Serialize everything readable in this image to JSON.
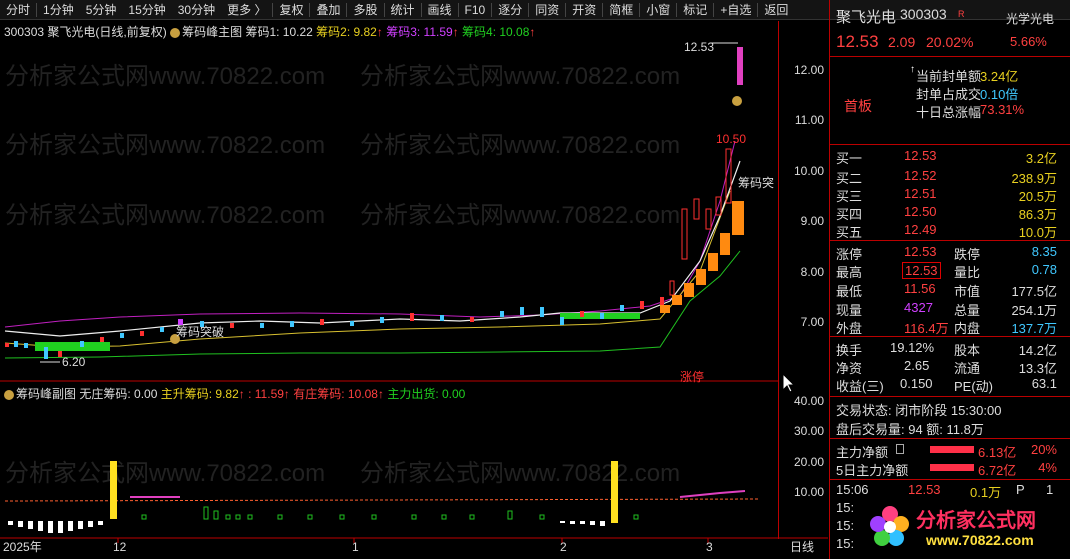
{
  "toolbar": {
    "items": [
      "分时",
      "1分钟",
      "5分钟",
      "15分钟",
      "30分钟",
      "更多 〉"
    ],
    "right_items": [
      "复权",
      "叠加",
      "多股",
      "统计",
      "画线",
      "F10",
      "逐分",
      "同资",
      "开资",
      "简框",
      "小窗",
      "标记",
      "+自选",
      "返回"
    ]
  },
  "main": {
    "code": "300303",
    "name": "聚飞光电",
    "period": "(日线,前复权)",
    "indicator": "筹码峰主图",
    "chip1_label": "筹码1: 10.22",
    "chip2_label": "筹码2: 9.82",
    "chip3_label": "筹码3: 11.59",
    "chip4_label": "筹码4: 10.08",
    "max_label": "12.53",
    "min_label": "6.20",
    "label_1050": "10.50",
    "breakout1": "筹码突破",
    "breakout2": "筹码突",
    "zhangting": "涨停"
  },
  "sub": {
    "title": "筹码峰副图",
    "nz": "无庄筹码: 0.00",
    "main_up": "主升筹码: 9.82",
    "blank_val": ": 11.59",
    "with_zhuang": "有庄筹码: 10.08",
    "main_out": "主力出货: 0.00"
  },
  "yaxis": {
    "main": [
      "12.00",
      "11.00",
      "10.00",
      "9.00",
      "8.00",
      "7.00"
    ],
    "sub": [
      "40.00",
      "30.00",
      "20.00",
      "10.00"
    ]
  },
  "xaxis": {
    "labels": [
      "2025年",
      "12",
      "1",
      "2",
      "3"
    ],
    "right": "日线"
  },
  "watermark": "分析家公式网www.70822.com",
  "panel": {
    "name": "聚飞光电",
    "code": "300303",
    "badge": "R",
    "price": "12.53",
    "change": "2.09",
    "pct": "20.02%",
    "sector": "光学光电",
    "sector_pct": "5.66%",
    "board": "首板",
    "seal_label": "当前封单额",
    "seal_val": "3.24亿",
    "seal_ratio_label": "封单占成交",
    "seal_ratio_val": "0.10倍",
    "ten_day_label": "十日总涨幅",
    "ten_day_val": "73.31%",
    "bids": [
      [
        "买一",
        "12.53",
        "3.2亿"
      ],
      [
        "买二",
        "12.52",
        "238.9万"
      ],
      [
        "买三",
        "12.51",
        "20.5万"
      ],
      [
        "买四",
        "12.50",
        "86.3万"
      ],
      [
        "买五",
        "12.49",
        "10.0万"
      ]
    ],
    "stats": [
      [
        "涨停",
        "12.53",
        "跌停",
        "8.35"
      ],
      [
        "最高",
        "12.53",
        "量比",
        "0.78"
      ],
      [
        "最低",
        "11.56",
        "市值",
        "177.5亿"
      ],
      [
        "现量",
        "4327",
        "总量",
        "254.1万"
      ],
      [
        "外盘",
        "116.4万",
        "内盘",
        "137.7万"
      ]
    ],
    "stats2": [
      [
        "换手",
        "19.12%",
        "股本",
        "14.2亿"
      ],
      [
        "净资",
        "2.65",
        "流通",
        "13.3亿"
      ],
      [
        "收益(三)",
        "0.150",
        "PE(动)",
        "63.1"
      ]
    ],
    "trade_status": "交易状态: 闭市阶段 15:30:00",
    "after": "盘后交易量: 94  额: 11.8万",
    "net1_label": "主力净额",
    "net1_val": "6.13亿",
    "net1_pct": "20%",
    "net5_label": "5日主力净额",
    "net5_val": "6.72亿",
    "net5_pct": "4%",
    "tick_time": "15:06",
    "tick_price": "12.53",
    "tick_vol": "0.1万",
    "tick_flag": "P",
    "tick_n": "1",
    "tick_times": [
      "15:06",
      "15:",
      "15:",
      "15:"
    ],
    "logo_text": "分析家公式网",
    "logo_url": "www.70822.com"
  }
}
